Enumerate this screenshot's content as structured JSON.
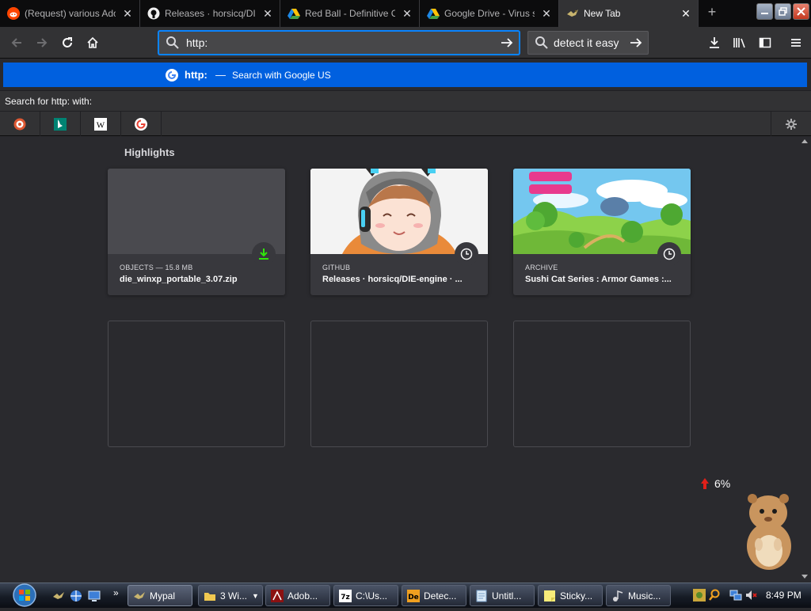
{
  "tabs": [
    {
      "title": "(Request) various Adobe",
      "favicon": "reddit-icon"
    },
    {
      "title": "Releases · horsicq/DIE",
      "favicon": "github-icon"
    },
    {
      "title": "Red Ball - Definitive C",
      "favicon": "google-drive-icon"
    },
    {
      "title": "Google Drive - Virus s",
      "favicon": "google-drive-icon"
    },
    {
      "title": "New Tab",
      "favicon": "mypal-icon"
    }
  ],
  "urlbar": {
    "value": "http:"
  },
  "searchbar": {
    "value": "detect it easy"
  },
  "popup": {
    "query": "http:",
    "separator": "—",
    "action": "Search with Google US",
    "search_with_label": "Search for http: with:"
  },
  "engines": [
    "duckduckgo-icon",
    "bing-icon",
    "wikipedia-icon",
    "google-icon"
  ],
  "highlights": {
    "heading": "Highlights",
    "cards": [
      {
        "context": "OBJECTS — 15.8 MB",
        "title": "die_winxp_portable_3.07.zip",
        "badge": "download-icon"
      },
      {
        "context": "GITHUB",
        "title": "Releases · horsicq/DIE-engine · ...",
        "badge": "clock-icon"
      },
      {
        "context": "ARCHIVE",
        "title": "Sushi Cat Series : Armor Games :...",
        "badge": "clock-icon"
      }
    ]
  },
  "cpu_widget": {
    "value": "6%"
  },
  "taskbar": {
    "buttons": [
      {
        "label": "Mypal",
        "active": true
      },
      {
        "label": "3 Wi..."
      },
      {
        "label": "Adob..."
      },
      {
        "label": "C:\\Us..."
      },
      {
        "label": "Detec..."
      },
      {
        "label": "Untitl..."
      },
      {
        "label": "Sticky..."
      },
      {
        "label": "Music..."
      }
    ],
    "clock": "8:49 PM"
  },
  "colors": {
    "accent": "#0a84ff",
    "popup_highlight": "#0060df",
    "background": "#2a2a2e",
    "toolbar": "#323234"
  }
}
